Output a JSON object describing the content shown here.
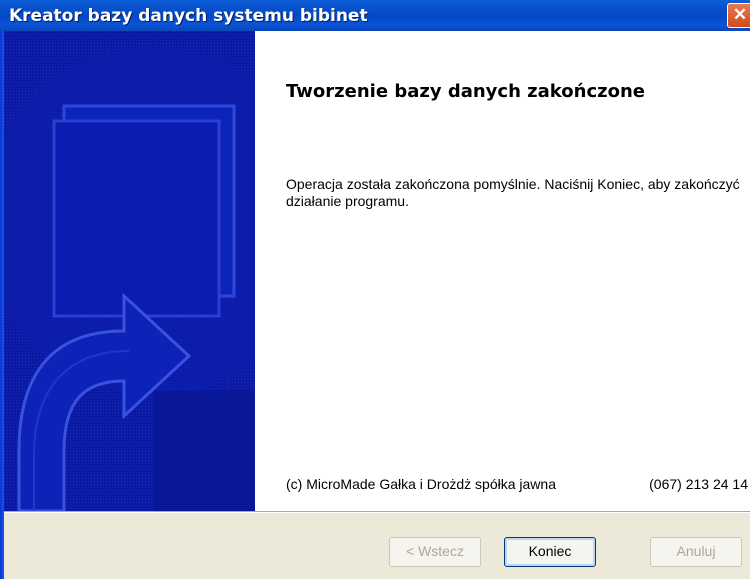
{
  "window": {
    "title": "Kreator bazy danych systemu bibinet",
    "close_symbol": "✕"
  },
  "page": {
    "heading": "Tworzenie bazy danych zakończone",
    "message": "Operacja została zakończona pomyślnie.  Naciśnij Koniec, aby zakończyć działanie programu.",
    "copyright": "(c) MicroMade Gałka i Drożdż spółka jawna",
    "phone": "(067) 213 24 14"
  },
  "buttons": {
    "back": "< Wstecz",
    "finish": "Koniec",
    "cancel": "Anuluj"
  },
  "colors": {
    "titlebar": "#0249c6",
    "side_panel": "#0a1aa4",
    "dialog_bg": "#ece9d8",
    "close_button": "#d04a1f"
  },
  "icons": {
    "close": "close-icon",
    "wizard_art": "wizard-arrow-graphic"
  }
}
